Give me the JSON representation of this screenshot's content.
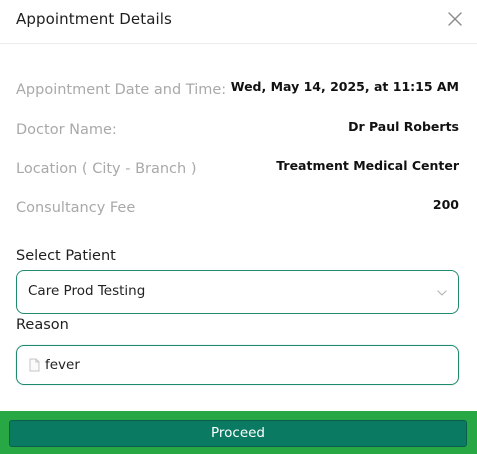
{
  "dialog": {
    "title": "Appointment Details"
  },
  "details": [
    {
      "label": "Appointment Date and Time:",
      "value": "Wed, May 14, 2025, at 11:15 AM"
    },
    {
      "label": "Doctor Name:",
      "value": "Dr Paul Roberts"
    },
    {
      "label": "Location ( City - Branch )",
      "value": "Treatment Medical Center"
    },
    {
      "label": "Consultancy Fee",
      "value": "200"
    }
  ],
  "patient": {
    "label": "Select Patient",
    "selected": "Care Prod Testing"
  },
  "reason": {
    "label": "Reason",
    "value": "fever"
  },
  "actions": {
    "proceed_label": "Proceed"
  },
  "colors": {
    "accent": "#0b7a62",
    "field_border": "#1f8a6e",
    "footer_highlight": "#27a845"
  },
  "icons": {
    "close": "close-icon",
    "select": "chevron-down-icon",
    "reason": "document-icon"
  }
}
